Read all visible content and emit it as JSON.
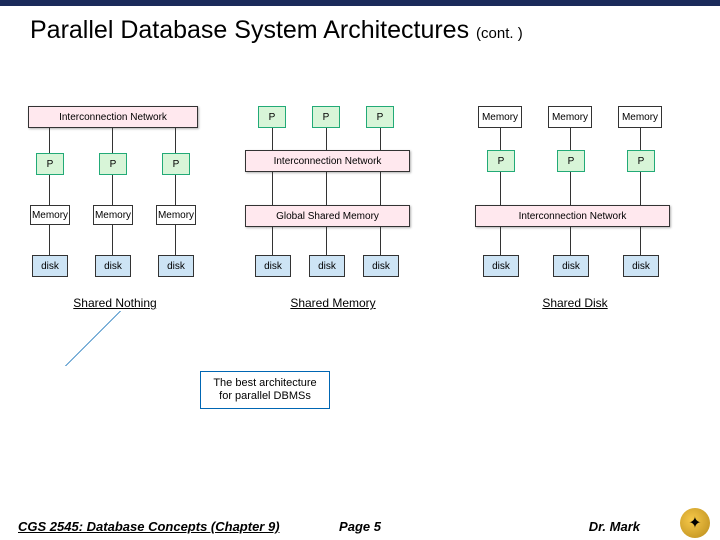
{
  "title": "Parallel Database System Architectures",
  "title_cont": "(cont. )",
  "labels": {
    "p": "P",
    "memory": "Memory",
    "disk": "disk",
    "interconnection": "Interconnection Network",
    "gsm": "Global Shared Memory"
  },
  "captions": {
    "left": "Shared Nothing",
    "mid": "Shared Memory",
    "right": "Shared Disk"
  },
  "callout": {
    "line1": "The best architecture",
    "line2": "for parallel DBMSs"
  },
  "footer": {
    "left": "CGS 2545: Database Concepts  (Chapter 9)",
    "mid": "Page 5",
    "right": "Dr. Mark"
  },
  "chart_data": {
    "type": "diagram",
    "architectures": [
      {
        "name": "Shared Nothing",
        "top": "Interconnection Network",
        "nodes": [
          {
            "processor": "P",
            "memory": "Memory",
            "disk": "disk"
          },
          {
            "processor": "P",
            "memory": "Memory",
            "disk": "disk"
          },
          {
            "processor": "P",
            "memory": "Memory",
            "disk": "disk"
          }
        ],
        "callout": "The best architecture for parallel DBMSs"
      },
      {
        "name": "Shared Memory",
        "top_row": [
          "P",
          "P",
          "P"
        ],
        "middle": "Interconnection Network",
        "shared": "Global Shared Memory",
        "disks": [
          "disk",
          "disk",
          "disk"
        ]
      },
      {
        "name": "Shared Disk",
        "top_row": [
          "Memory",
          "Memory",
          "Memory"
        ],
        "processors": [
          "P",
          "P",
          "P"
        ],
        "middle": "Interconnection Network",
        "disks": [
          "disk",
          "disk",
          "disk"
        ]
      }
    ]
  }
}
